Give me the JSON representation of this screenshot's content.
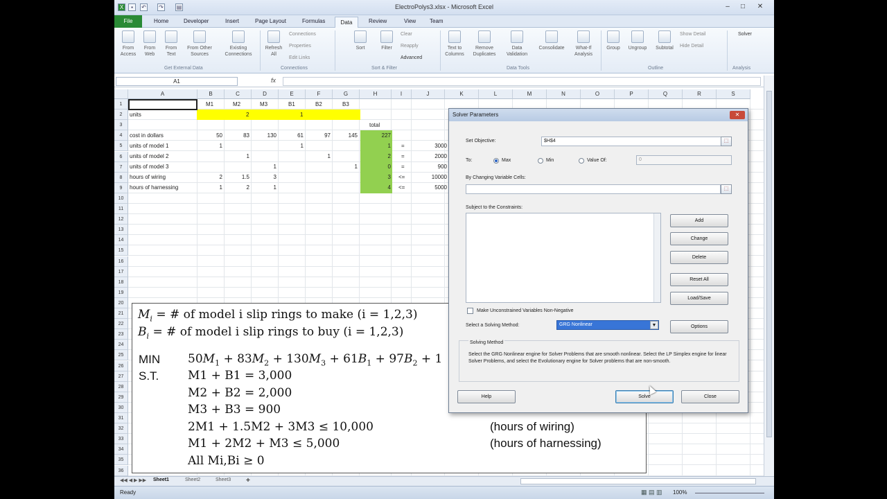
{
  "window": {
    "title": "ElectroPolys3.xlsx - Microsoft Excel"
  },
  "quick_access": {
    "icons": [
      "excel-icon",
      "save-icon",
      "undo-icon",
      "redo-icon",
      "print-preview-icon"
    ]
  },
  "tabs": [
    "File",
    "Home",
    "Developer",
    "Insert",
    "Page Layout",
    "Formulas",
    "Data",
    "Review",
    "View",
    "Team"
  ],
  "ribbon": {
    "get_external": [
      "From Access",
      "From Web",
      "From Text",
      "From Other Sources",
      "Existing Connections"
    ],
    "get_external_label": "Get External Data",
    "refresh": "Refresh All",
    "connections_items": [
      "Connections",
      "Properties",
      "Edit Links"
    ],
    "connections_label": "Connections",
    "sort_filter": [
      "Sort",
      "Filter"
    ],
    "sort_items": [
      "Clear",
      "Reapply",
      "Advanced"
    ],
    "sort_label": "Sort & Filter",
    "data_tools": [
      "Text to Columns",
      "Remove Duplicates",
      "Data Validation",
      "Consolidate",
      "What-If Analysis"
    ],
    "data_tools_label": "Data Tools",
    "outline": [
      "Group",
      "Ungroup",
      "Subtotal"
    ],
    "outline_items": [
      "Show Detail",
      "Hide Detail"
    ],
    "outline_label": "Outline",
    "solver": "Solver",
    "analysis_label": "Analysis"
  },
  "formula_bar": {
    "name_box": "A1",
    "fx": "fx",
    "value": ""
  },
  "columns": [
    "A",
    "B",
    "C",
    "D",
    "E",
    "F",
    "G",
    "H",
    "I",
    "J",
    "K",
    "L",
    "M",
    "N",
    "O",
    "P",
    "Q",
    "R",
    "S"
  ],
  "rows": [
    "1",
    "2",
    "3",
    "4",
    "5",
    "6",
    "7",
    "8",
    "9",
    "10",
    "11",
    "12",
    "13",
    "14",
    "15",
    "16",
    "17",
    "18",
    "19",
    "20",
    "21",
    "22",
    "23",
    "24",
    "25",
    "26",
    "27",
    "28",
    "29",
    "30",
    "31",
    "32",
    "33",
    "34",
    "35",
    "36"
  ],
  "sheet": {
    "row1": [
      "M1",
      "M2",
      "M3",
      "B1",
      "B2",
      "B3"
    ],
    "row2": {
      "label": "units",
      "v1": "2",
      "v2": "1"
    },
    "row3": {
      "total": "total"
    },
    "row4": {
      "label": "cost in dollars",
      "vals": [
        "50",
        "83",
        "130",
        "61",
        "97",
        "145"
      ],
      "total": "227"
    },
    "row5": {
      "label": "units of model 1",
      "b": "1",
      "e": "1",
      "h": "1",
      "op": "=",
      "rhs": "3000"
    },
    "row6": {
      "label": "units of model 2",
      "c": "1",
      "f": "1",
      "h": "2",
      "op": "=",
      "rhs": "2000"
    },
    "row7": {
      "label": "units of model 3",
      "d": "1",
      "g": "1",
      "h": "0",
      "op": "=",
      "rhs": "900"
    },
    "row8": {
      "label": "hours of wiring",
      "b": "2",
      "c": "1.5",
      "d": "3",
      "h": "3",
      "op": "<=",
      "rhs": "10000"
    },
    "row9": {
      "label": "hours of harnessing",
      "b": "1",
      "c": "2",
      "d": "1",
      "h": "4",
      "op": "<=",
      "rhs": "5000"
    }
  },
  "textbox": {
    "mi_def": "= # of model i slip rings to make (i = 1,2,3)",
    "bi_def": "= # of model i slip rings to buy (i = 1,2,3)",
    "min": "MIN",
    "st": "S.T.",
    "c1": "M1 + B1 = 3,000",
    "c2": "M2 + B2 = 2,000",
    "c3": "M3 + B3 = 900",
    "c4": "2M1 + 1.5M2 + 3M3 ≤ 10,000",
    "c5": "M1 + 2M2 + M3 ≤ 5,000",
    "c6": "All Mi,Bi ≥ 0",
    "ann_wiring": "(hours of wiring)",
    "ann_harness": "(hours of harnessing)"
  },
  "solver": {
    "title": "Solver Parameters",
    "set_objective_label": "Set Objective:",
    "objective_value": "$H$4",
    "to_label": "To:",
    "max": "Max",
    "min": "Min",
    "value_of": "Value Of:",
    "value_of_value": "0",
    "changing_label": "By Changing Variable Cells:",
    "constraints_label": "Subject to the Constraints:",
    "buttons": {
      "add": "Add",
      "change": "Change",
      "delete": "Delete",
      "reset_all": "Reset All",
      "load_save": "Load/Save",
      "options": "Options",
      "help": "Help",
      "solve": "Solve",
      "close": "Close"
    },
    "nonneg_label": "Make Unconstrained Variables Non-Negative",
    "method_label": "Select a Solving Method:",
    "method_value": "GRG Nonlinear",
    "solving_method_label": "Solving Method",
    "description": "Select the GRG Nonlinear engine for Solver Problems that are smooth nonlinear. Select the LP Simplex engine for linear Solver Problems, and select the Evolutionary engine for Solver problems that are non-smooth."
  },
  "sheet_tabs": [
    "Sheet1",
    "Sheet2",
    "Sheet3"
  ],
  "status": {
    "ready": "Ready",
    "zoom": "100%"
  },
  "colors": {
    "yellow": "#ffff00",
    "green": "#92d050",
    "excel_green": "#2a8a35",
    "title_blue": "#c6d7ee"
  }
}
